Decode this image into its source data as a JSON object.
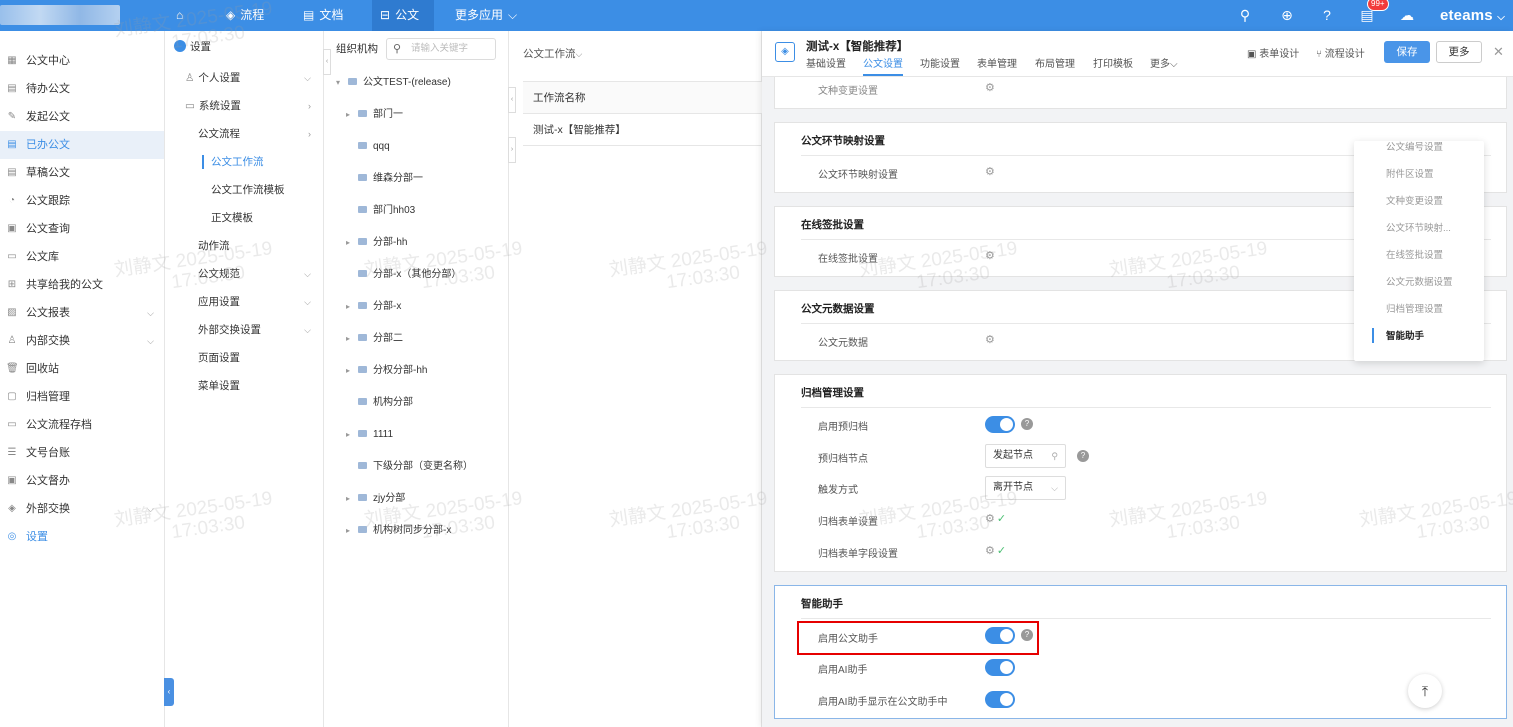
{
  "topbar": {
    "nav": [
      {
        "label": "",
        "icon": "home-icon"
      },
      {
        "label": "流程",
        "icon": "layers-icon"
      },
      {
        "label": "文档",
        "icon": "file-icon"
      },
      {
        "label": "公文",
        "icon": "inbox-icon"
      },
      {
        "label": "更多应用",
        "icon": "chevron-down-icon"
      }
    ],
    "badge": "99+",
    "brand": "eteams"
  },
  "leftnav": [
    {
      "label": "公文中心",
      "icon": "grid-icon"
    },
    {
      "label": "待办公文",
      "icon": "doc-icon"
    },
    {
      "label": "发起公文",
      "icon": "edit-icon"
    },
    {
      "label": "已办公文",
      "icon": "done-icon"
    },
    {
      "label": "草稿公文",
      "icon": "draft-icon"
    },
    {
      "label": "公文跟踪",
      "icon": "clock-icon"
    },
    {
      "label": "公文查询",
      "icon": "search-doc-icon"
    },
    {
      "label": "公文库",
      "icon": "archive-icon"
    },
    {
      "label": "共享给我的公文",
      "icon": "share-icon"
    },
    {
      "label": "公文报表",
      "icon": "report-icon"
    },
    {
      "label": "内部交换",
      "icon": "user-icon"
    },
    {
      "label": "回收站",
      "icon": "trash-icon"
    },
    {
      "label": "归档管理",
      "icon": "box-icon"
    },
    {
      "label": "公文流程存档",
      "icon": "folder-icon"
    },
    {
      "label": "文号台账",
      "icon": "list-icon"
    },
    {
      "label": "公文督办",
      "icon": "check-icon"
    },
    {
      "label": "外部交换",
      "icon": "stack-icon"
    },
    {
      "label": "设置",
      "icon": "settings-icon"
    }
  ],
  "settings_col": {
    "title": "设置",
    "items": [
      "个人设置",
      "系统设置",
      "公文流程",
      "公文工作流",
      "公文工作流模板",
      "正文模板",
      "动作流",
      "公文规范",
      "应用设置",
      "外部交换设置",
      "页面设置",
      "菜单设置"
    ]
  },
  "org": {
    "header": "组织机构",
    "search_placeholder": "请输入关键字",
    "tree": [
      "公文TEST-(release)",
      "部门一",
      "qqq",
      "维森分部一",
      "部门hh03",
      "分部-hh",
      "分部-x（其他分部）",
      "分部-x",
      "分部二",
      "分权分部-hh",
      "机构分部",
      "1111",
      "下级分部（变更名称）",
      "zjy分部",
      "机构树同步分部-x"
    ]
  },
  "workflow": {
    "dropdown": "公文工作流",
    "column": "工作流名称",
    "row": "测试-x【智能推荐】"
  },
  "panel": {
    "title": "测试-x【智能推荐】",
    "tabs": [
      "基础设置",
      "公文设置",
      "功能设置",
      "表单管理",
      "布局管理",
      "打印模板",
      "更多"
    ],
    "actions": {
      "form_design": "表单设计",
      "flow_design": "流程设计",
      "save": "保存",
      "more": "更多"
    },
    "sections": {
      "doc_change_row": "文种变更设置",
      "link_mapping": {
        "title": "公文环节映射设置",
        "row": "公文环节映射设置"
      },
      "online_sign": {
        "title": "在线签批设置",
        "row": "在线签批设置"
      },
      "metadata": {
        "title": "公文元数据设置",
        "row": "公文元数据"
      },
      "archive": {
        "title": "归档管理设置",
        "rows": [
          "启用预归档",
          "预归档节点",
          "触发方式",
          "归档表单设置",
          "归档表单字段设置"
        ],
        "pre_node_value": "发起节点",
        "trigger_value": "离开节点"
      },
      "assistant": {
        "title": "智能助手",
        "rows": [
          "启用公文助手",
          "启用AI助手",
          "启用AI助手显示在公文助手中"
        ]
      }
    },
    "anchor": [
      "公文编号设置",
      "附件区设置",
      "文种变更设置",
      "公文环节映射...",
      "在线签批设置",
      "公文元数据设置",
      "归档管理设置",
      "智能助手"
    ]
  },
  "watermark": {
    "name": "刘静文",
    "date": "2025-05-19",
    "time": "17:03:30"
  },
  "colors": {
    "primary": "#3c8ee5",
    "highlight": "#e60000"
  }
}
